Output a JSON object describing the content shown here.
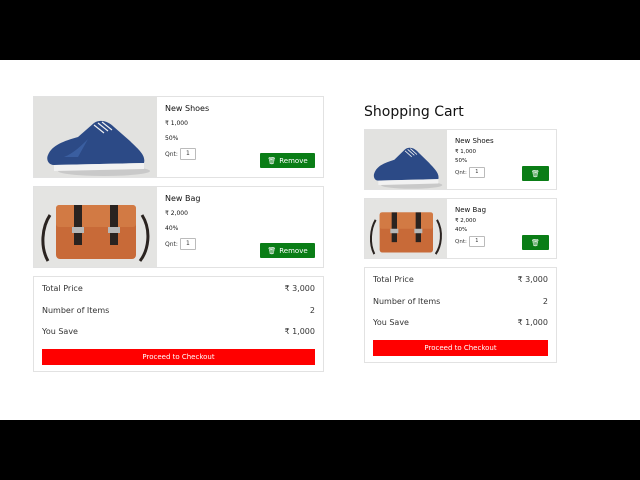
{
  "left": {
    "items": [
      {
        "name": "New Shoes",
        "price": "₹ 1,000",
        "discount": "50%",
        "qty_label": "Qnt:",
        "qty": "1",
        "remove_label": "Remove",
        "image": "shoe-image"
      },
      {
        "name": "New Bag",
        "price": "₹ 2,000",
        "discount": "40%",
        "qty_label": "Qnt:",
        "qty": "1",
        "remove_label": "Remove",
        "image": "bag-image"
      }
    ],
    "summary": {
      "total_label": "Total Price",
      "total_value": "₹ 3,000",
      "count_label": "Number of Items",
      "count_value": "2",
      "save_label": "You Save",
      "save_value": "₹ 1,000",
      "checkout_label": "Proceed to Checkout"
    }
  },
  "right": {
    "title": "Shopping Cart",
    "items": [
      {
        "name": "New Shoes",
        "price": "₹ 1,000",
        "discount": "50%",
        "qty_label": "Qnt:",
        "qty": "1",
        "image": "shoe-image",
        "icon": "trash-icon"
      },
      {
        "name": "New Bag",
        "price": "₹ 2,000",
        "discount": "40%",
        "qty_label": "Qnt:",
        "qty": "1",
        "image": "bag-image",
        "icon": "trash-icon"
      }
    ],
    "summary": {
      "total_label": "Total Price",
      "total_value": "₹ 3,000",
      "count_label": "Number of Items",
      "count_value": "2",
      "save_label": "You Save",
      "save_value": "₹ 1,000",
      "checkout_label": "Proceed to Checkout"
    }
  },
  "colors": {
    "remove": "#0a7d16",
    "checkout": "#ff0000"
  }
}
